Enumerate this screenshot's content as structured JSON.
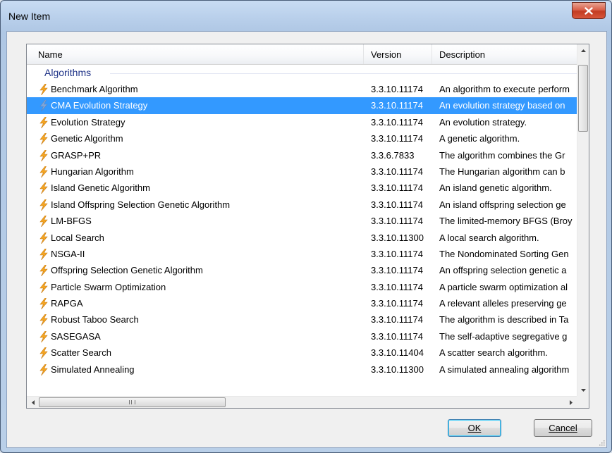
{
  "window": {
    "title": "New Item",
    "close_label": "x"
  },
  "columns": {
    "name": "Name",
    "version": "Version",
    "description": "Description"
  },
  "group": {
    "label": "Algorithms"
  },
  "rows": [
    {
      "name": "Benchmark Algorithm",
      "version": "3.3.10.11174",
      "description": "An algorithm to execute perform",
      "selected": false
    },
    {
      "name": "CMA Evolution Strategy",
      "version": "3.3.10.11174",
      "description": "An evolution strategy based on",
      "selected": true
    },
    {
      "name": "Evolution Strategy",
      "version": "3.3.10.11174",
      "description": "An evolution strategy.",
      "selected": false
    },
    {
      "name": "Genetic Algorithm",
      "version": "3.3.10.11174",
      "description": "A genetic algorithm.",
      "selected": false
    },
    {
      "name": "GRASP+PR",
      "version": "3.3.6.7833",
      "description": "The algorithm combines the Gr",
      "selected": false
    },
    {
      "name": "Hungarian Algorithm",
      "version": "3.3.10.11174",
      "description": "The Hungarian algorithm can b",
      "selected": false
    },
    {
      "name": "Island Genetic Algorithm",
      "version": "3.3.10.11174",
      "description": "An island genetic algorithm.",
      "selected": false
    },
    {
      "name": "Island Offspring Selection Genetic Algorithm",
      "version": "3.3.10.11174",
      "description": "An island offspring selection ge",
      "selected": false
    },
    {
      "name": "LM-BFGS",
      "version": "3.3.10.11174",
      "description": "The limited-memory BFGS (Broy",
      "selected": false
    },
    {
      "name": "Local Search",
      "version": "3.3.10.11300",
      "description": "A local search algorithm.",
      "selected": false
    },
    {
      "name": "NSGA-II",
      "version": "3.3.10.11174",
      "description": "The Nondominated Sorting Gen",
      "selected": false
    },
    {
      "name": "Offspring Selection Genetic Algorithm",
      "version": "3.3.10.11174",
      "description": "An offspring selection genetic a",
      "selected": false
    },
    {
      "name": "Particle Swarm Optimization",
      "version": "3.3.10.11174",
      "description": "A particle swarm optimization al",
      "selected": false
    },
    {
      "name": "RAPGA",
      "version": "3.3.10.11174",
      "description": "A relevant alleles preserving ge",
      "selected": false
    },
    {
      "name": "Robust Taboo Search",
      "version": "3.3.10.11174",
      "description": "The algorithm is described in Ta",
      "selected": false
    },
    {
      "name": "SASEGASA",
      "version": "3.3.10.11174",
      "description": "The self-adaptive segregative g",
      "selected": false
    },
    {
      "name": "Scatter Search",
      "version": "3.3.10.11404",
      "description": "A scatter search algorithm.",
      "selected": false
    },
    {
      "name": "Simulated Annealing",
      "version": "3.3.10.11300",
      "description": "A simulated annealing algorithm",
      "selected": false
    }
  ],
  "buttons": {
    "ok": "OK",
    "cancel": "Cancel"
  },
  "colors": {
    "selection": "#3399ff",
    "group_header": "#1e3287",
    "icon_normal": "#f5a623",
    "icon_selected": "#7fa6d8"
  },
  "icons": {
    "row_icon": "lightning-bolt-icon"
  }
}
